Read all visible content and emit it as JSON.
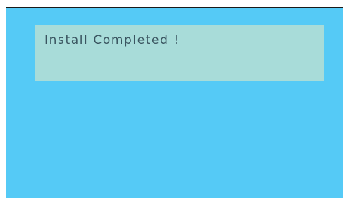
{
  "colors": {
    "screen_background": "#55CAF6",
    "panel_background": "#A8DCD9",
    "text": "#3A5560"
  },
  "status_panel": {
    "message": "Install Completed !"
  }
}
